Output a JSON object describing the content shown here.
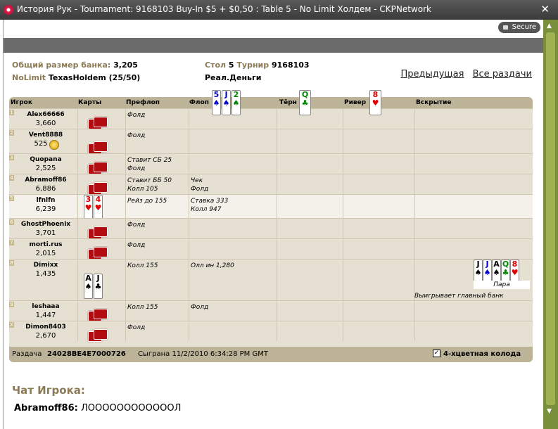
{
  "window": {
    "title": "История Рук - Tournament: 9168103 Buy-In $5 + $0,50 : Table 5 - No Limit Холдем - CKPNetwork",
    "close": "✕",
    "secure": "Secure"
  },
  "info": {
    "pot_label": "Общий размер банка:",
    "pot": "3,205",
    "game_label": "NoLimit",
    "game": "TexasHoldem",
    "game_limits": "(25/50)",
    "table_label": "Стол",
    "table": "5",
    "tourn_label": "Турнир",
    "tourn": "9168103",
    "money": "Реал.Деньги",
    "prev": "Предыдущая",
    "all": "Все раздачи"
  },
  "headers": {
    "player": "Игрок",
    "cards": "Карты",
    "preflop": "Префлоп",
    "flop": "Флоп",
    "turn": "Тёрн",
    "river": "Ривер",
    "showdown": "Вскрытие"
  },
  "board": {
    "flop": [
      {
        "r": "5",
        "s": "♠",
        "c": "blu"
      },
      {
        "r": "J",
        "s": "♠",
        "c": "blu"
      },
      {
        "r": "2",
        "s": "♠",
        "c": "grn"
      }
    ],
    "turn": {
      "r": "Q",
      "s": "♣",
      "c": "grn"
    },
    "river": {
      "r": "8",
      "s": "♥",
      "c": "red"
    }
  },
  "rows": [
    {
      "n": "1",
      "name": "Alex66666",
      "stack": "3,660",
      "pre": "Фолд",
      "flop": ""
    },
    {
      "n": "2",
      "name": "Vent8888",
      "stack": "525",
      "pre": "Фолд",
      "flop": ""
    },
    {
      "n": "3",
      "name": "Quopana",
      "stack": "2,525",
      "pre": "Ставит СБ 25\nФолд",
      "flop": ""
    },
    {
      "n": "4",
      "name": "Abramoff86",
      "stack": "6,886",
      "pre": "Ставит ББ 50\nКолл 105",
      "flop": "Чек\nФолд"
    },
    {
      "n": "5",
      "name": "lfnlfn",
      "stack": "6,239",
      "pre": "Рейз до 155",
      "flop": "Ставка 333\nКолл 947"
    },
    {
      "n": "6",
      "name": "GhostPhoenix",
      "stack": "3,701",
      "pre": "Фолд",
      "flop": ""
    },
    {
      "n": "7",
      "name": "morti.rus",
      "stack": "2,015",
      "pre": "Фолд",
      "flop": ""
    },
    {
      "n": "8",
      "name": "Dimixx",
      "stack": "1,435",
      "pre": "Колл 155",
      "flop": "Олл ин 1,280"
    },
    {
      "n": "9",
      "name": "leshaaa",
      "stack": "1,447",
      "pre": "Колл 155",
      "flop": "Фолд"
    },
    {
      "n": "X",
      "name": "Dimon8403",
      "stack": "2,670",
      "pre": "Фолд",
      "flop": ""
    }
  ],
  "hand5": [
    {
      "r": "3",
      "s": "♥",
      "c": "red"
    },
    {
      "r": "4",
      "s": "♥",
      "c": "red"
    }
  ],
  "hand8": [
    {
      "r": "A",
      "s": "♠",
      "c": "blk"
    },
    {
      "r": "J",
      "s": "♣",
      "c": "blk"
    }
  ],
  "showdown8": {
    "cards": [
      {
        "r": "J",
        "s": "♠",
        "c": "blk"
      },
      {
        "r": "J",
        "s": "♠",
        "c": "blu"
      },
      {
        "r": "A",
        "s": "♠",
        "c": "blk"
      },
      {
        "r": "Q",
        "s": "♣",
        "c": "grn"
      },
      {
        "r": "8",
        "s": "♥",
        "c": "red"
      }
    ],
    "hand": "Пара",
    "result": "Выигрывает главный банк"
  },
  "footer": {
    "hand_label": "Раздача",
    "hand_id": "24028BE4E7000726",
    "played": "Сыграна 11/2/2010 6:34:28 PM GMT",
    "fourcolor": "4-хцветная колода"
  },
  "chat": {
    "title": "Чат Игрока:",
    "user": "Abramoff86:",
    "msg": "ЛООООООООООООЛ"
  }
}
